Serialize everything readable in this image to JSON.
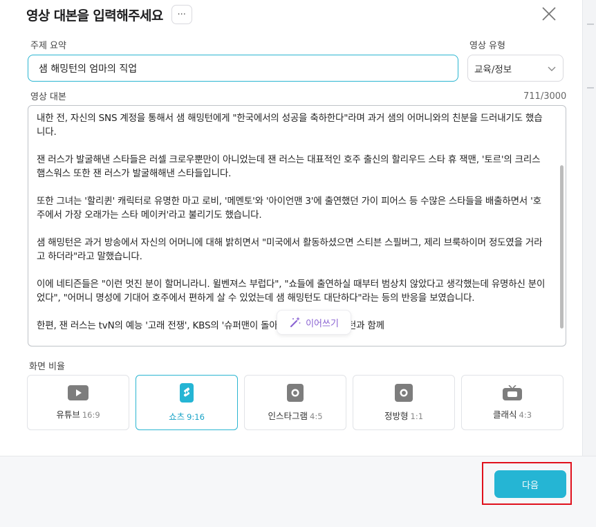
{
  "dialog": {
    "title": "영상 대본을 입력해주세요",
    "more_label": "···"
  },
  "topic": {
    "label": "주제 요약",
    "value": "샘 해밍턴의 엄마의 직업"
  },
  "video_type": {
    "label": "영상 유형",
    "selected": "교육/정보"
  },
  "script": {
    "label": "영상 대본",
    "count": "711/3000",
    "paragraphs": [
      "내한 전, 자신의 SNS 계정을 통해서 샘 해밍턴에게 \"한국에서의 성공을 축하한다\"라며 과거 샘의 어머니와의 친분을 드러내기도 했습니다.",
      "잰 러스가 발굴해낸 스타들은 러셀 크로우뿐만이 아니었는데 잰 러스는 대표적인 호주 출신의 할리우드 스타 휴 잭맨, '토르'의 크리스 햄스워스 또한 잰 러스가 발굴해해낸 스타들입니다.",
      "또한 그녀는 '할리퀸' 캐릭터로 유명한 마고 로비, '메멘토'와 '아이언맨 3'에 출연했던 가이 피어스 등 수많은 스타들을 배출하면서 '호주에서 가장 오래가는 스타 메이커'라고 불리기도 했습니다.",
      "샘 해밍턴은 과거 방송에서 자신의 어머니에 대해 밝히면서 \"미국에서 활동하셨으면 스티븐 스필버그, 제리 브룩하이머 정도였을 거라고 하더라\"라고 말했습니다.",
      "이에 네티즌들은 \"이런 멋진 분이 할머니라니. 윌벤져스 부럽다\", \"쇼들에 출연하실 때부터 범상치 않았다고 생각했는데 유명하신 분이었다\", \"어머니 명성에 기대어 호주에서 편하게 살 수 있었는데 샘 해밍턴도 대단하다\"라는 등의 반응을 보였습니다.",
      "한편, 잰 러스는 tvN의 예능 '고래 전쟁', KBS의 '슈퍼맨이 돌아왔다' 등에 샘 해밍턴과 함께"
    ],
    "continue_label": "이어쓰기"
  },
  "ratio": {
    "label": "화면 비율",
    "options": [
      {
        "name": "유튜브",
        "ratio": "16:9",
        "icon": "youtube-icon"
      },
      {
        "name": "쇼츠",
        "ratio": "9:16",
        "icon": "shorts-icon"
      },
      {
        "name": "인스타그램",
        "ratio": "4:5",
        "icon": "instagram-icon"
      },
      {
        "name": "정방형",
        "ratio": "1:1",
        "icon": "square-icon"
      },
      {
        "name": "클래식",
        "ratio": "4:3",
        "icon": "tv-icon"
      }
    ],
    "selected_index": 1
  },
  "footer": {
    "next_label": "다음"
  },
  "colors": {
    "accent": "#25b5d4",
    "highlight_frame": "#e0101c",
    "continue_text": "#8a63d2"
  }
}
